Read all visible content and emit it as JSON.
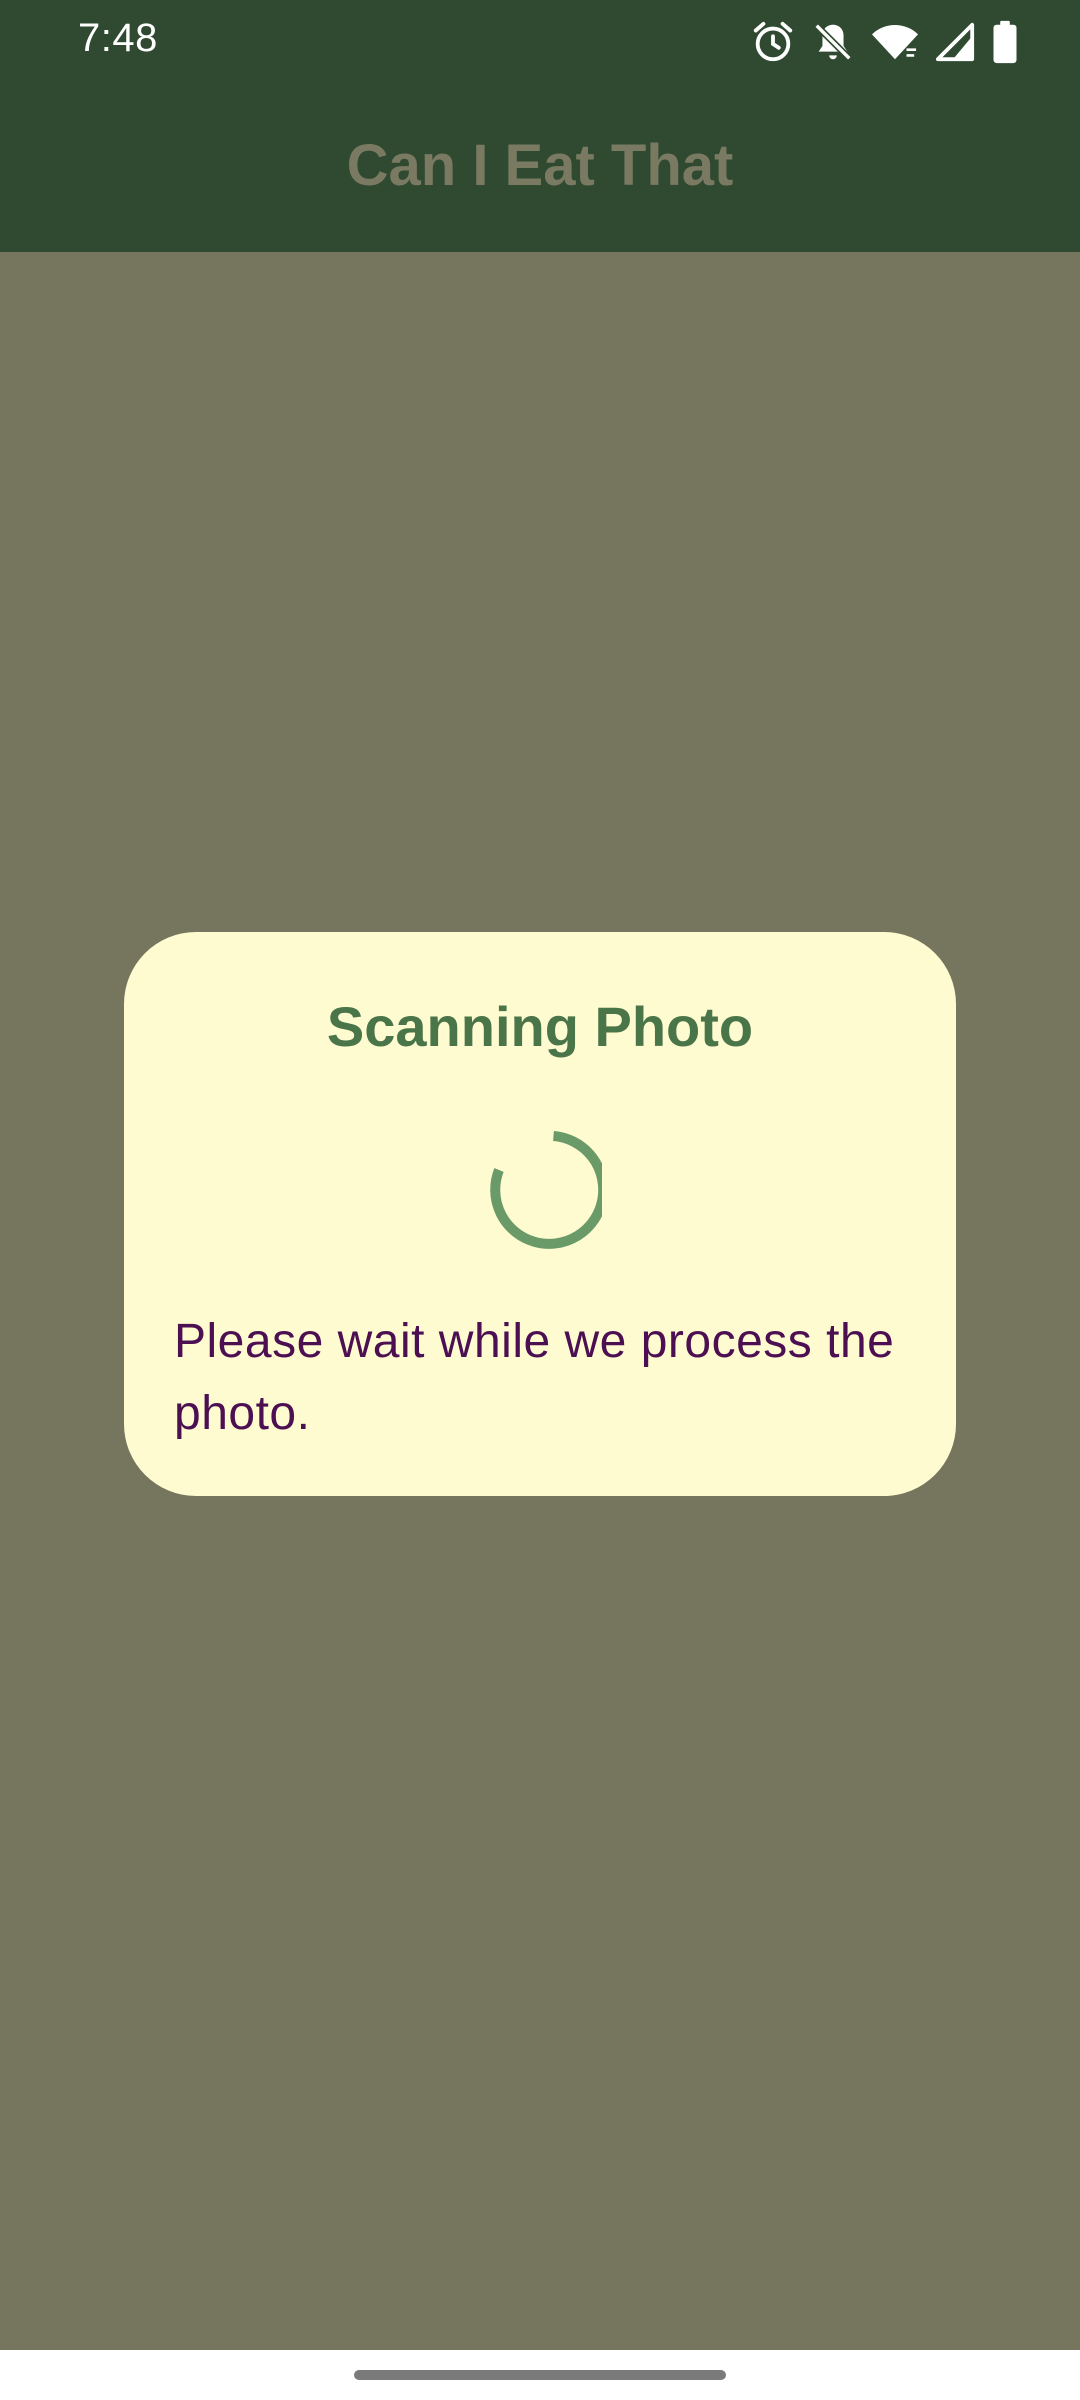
{
  "status_bar": {
    "time": "7:48",
    "icons": [
      "alarm-icon",
      "notifications-off-icon",
      "wifi-icon",
      "cell-signal-icon",
      "battery-icon"
    ]
  },
  "app_bar": {
    "title": "Can I Eat That"
  },
  "dialog": {
    "title": "Scanning Photo",
    "message": "Please wait while we process the photo.",
    "spinner": "progress-spinner-icon"
  },
  "colors": {
    "app_bar": "#2f4a30",
    "scrim": "#76765f",
    "dialog_background": "#fffbd1",
    "dialog_title": "#4a7548",
    "dialog_message": "#4b0f52",
    "spinner": "#6a9a68"
  }
}
